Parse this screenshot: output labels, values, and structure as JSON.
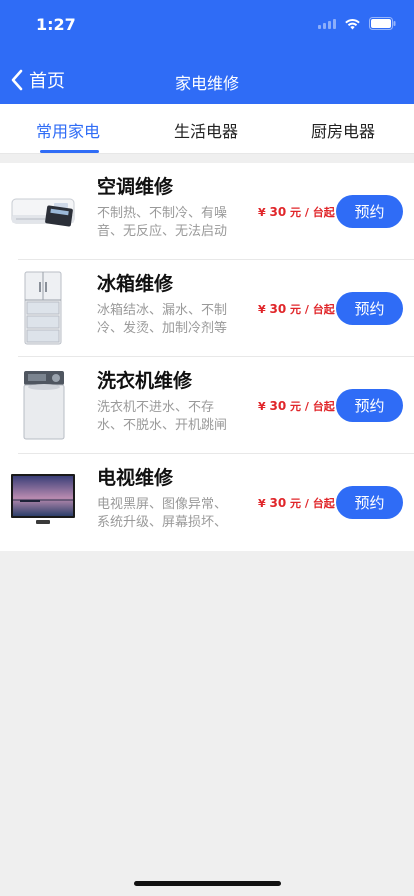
{
  "status_bar": {
    "time": "1:27"
  },
  "nav": {
    "back_label": "首页",
    "title": "家电维修"
  },
  "tabs": [
    {
      "label": "常用家电",
      "active": true
    },
    {
      "label": "生活电器",
      "active": false
    },
    {
      "label": "厨房电器",
      "active": false
    }
  ],
  "items": [
    {
      "title": "空调维修",
      "desc": "不制热、不制冷、有噪音、无反应、无法启动",
      "price_prefix": "¥ ",
      "price_num": "30",
      "price_suffix": " 元 / 台起",
      "button": "预约",
      "icon": "air-conditioner"
    },
    {
      "title": "冰箱维修",
      "desc": "冰箱结冰、漏水、不制冷、发烫、加制冷剂等",
      "price_prefix": "¥ ",
      "price_num": "30",
      "price_suffix": " 元 / 台起",
      "button": "预约",
      "icon": "refrigerator"
    },
    {
      "title": "洗衣机维修",
      "desc": "洗衣机不进水、不存水、不脱水、开机跳闸",
      "price_prefix": "¥ ",
      "price_num": "30",
      "price_suffix": " 元 / 台起",
      "button": "预约",
      "icon": "washing-machine"
    },
    {
      "title": "电视维修",
      "desc": "电视黑屏、图像异常、系统升级、屏幕损坏、",
      "price_prefix": "¥ ",
      "price_num": "30",
      "price_suffix": " 元 / 台起",
      "button": "预约",
      "icon": "television"
    }
  ],
  "colors": {
    "accent": "#2f6cf6",
    "price": "#e0262a",
    "background": "#efefef"
  }
}
